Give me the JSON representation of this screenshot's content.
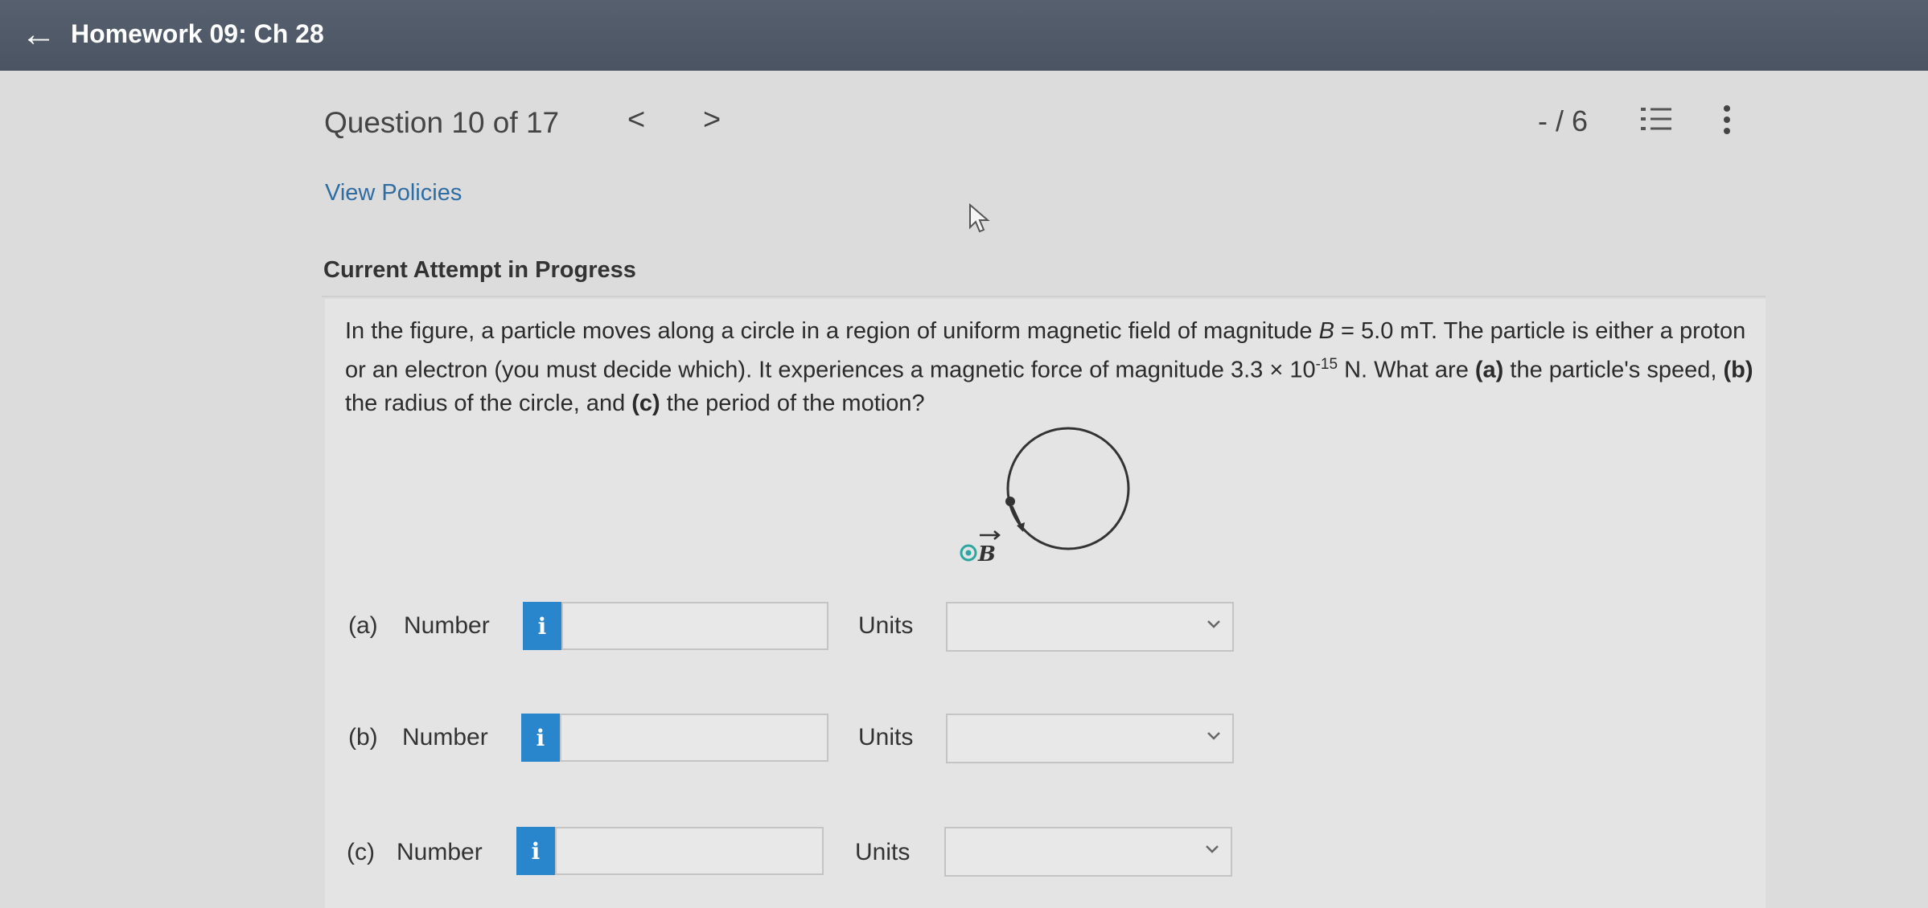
{
  "header": {
    "title": "Homework 09: Ch 28"
  },
  "question_bar": {
    "title": "Question 10 of 17",
    "prev": "<",
    "next": ">",
    "score": "- / 6"
  },
  "links": {
    "view_policies": "View Policies"
  },
  "attempt": {
    "heading": "Current Attempt in Progress"
  },
  "question": {
    "part1": "In the figure, a particle moves along a circle in a region of uniform magnetic field of magnitude ",
    "B_symbol": "B",
    "part2": " = 5.0 mT. The particle is either a proton or an electron (you must decide which). It experiences a magnetic force of magnitude 3.3 × 10",
    "exponent": "-15",
    "part3": " N. What are ",
    "a_label": "(a)",
    "part4": " the particle's speed, ",
    "b_label": "(b)",
    "part5": " the radius of the circle, and ",
    "c_label": "(c)",
    "part6": " the period of the motion?"
  },
  "figure": {
    "field_label": "B"
  },
  "answers": [
    {
      "label": "(a)",
      "number_label": "Number",
      "info": "i",
      "value": "",
      "units_label": "Units",
      "units_value": ""
    },
    {
      "label": "(b)",
      "number_label": "Number",
      "info": "i",
      "value": "",
      "units_label": "Units",
      "units_value": ""
    },
    {
      "label": "(c)",
      "number_label": "Number",
      "info": "i",
      "value": "",
      "units_label": "Units",
      "units_value": ""
    }
  ],
  "colors": {
    "header_bg": "#4f5966",
    "accent": "#2a86cc",
    "link": "#2e6da4"
  }
}
